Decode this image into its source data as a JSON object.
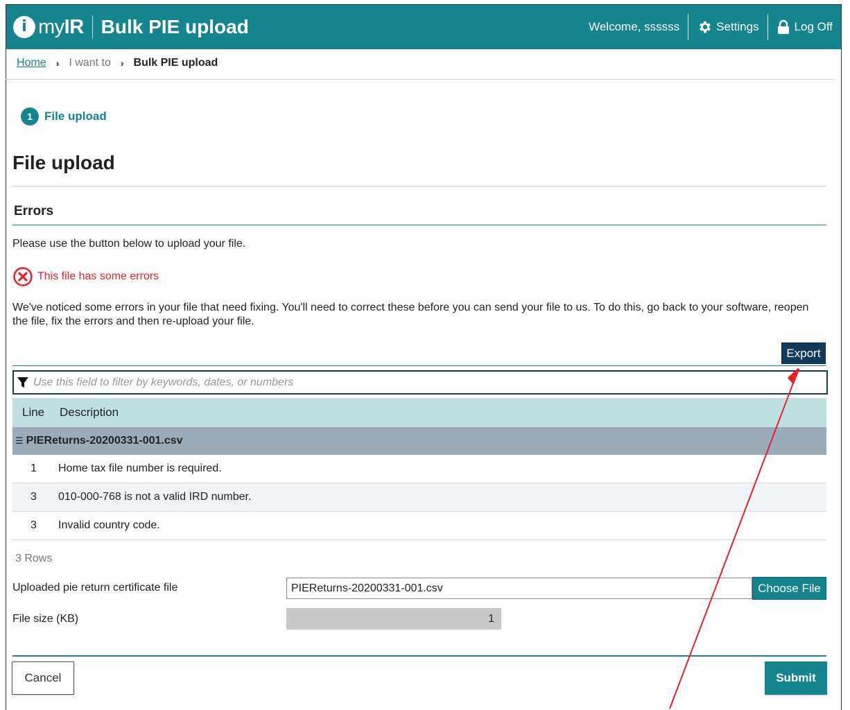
{
  "header": {
    "brand_prefix": "my",
    "brand_bold": "IR",
    "logo_glyph": "i",
    "app_title": "Bulk PIE upload",
    "welcome": "Welcome, ssssss",
    "settings_label": "Settings",
    "logoff_label": "Log Off"
  },
  "breadcrumb": {
    "home": "Home",
    "middle": "I want to",
    "current": "Bulk PIE upload"
  },
  "steps": [
    {
      "number": "1",
      "label": "File upload"
    }
  ],
  "page": {
    "title": "File upload",
    "section_title": "Errors",
    "intro": "Please use the button below to upload your file.",
    "error_message": "This file has some errors",
    "notice": "We've noticed some errors in your file that need fixing. You'll need to correct these before you can send your file to us. To do this, go back to your software, reopen the file, fix the errors and then re-upload your file."
  },
  "toolbar": {
    "export_label": "Export"
  },
  "filter": {
    "placeholder": "Use this field to filter by keywords, dates, or numbers"
  },
  "table": {
    "columns": [
      "Line",
      "Description"
    ],
    "group": "PIEReturns-20200331-001.csv",
    "rows": [
      {
        "line": "1",
        "description": "Home tax file number is required."
      },
      {
        "line": "3",
        "description": "010-000-768 is not a valid IRD number."
      },
      {
        "line": "3",
        "description": "Invalid country code."
      }
    ],
    "row_count": "3 Rows"
  },
  "form": {
    "file_label": "Uploaded pie return certificate file",
    "file_value": "PIEReturns-20200331-001.csv",
    "choose_label": "Choose File",
    "size_label": "File size (KB)",
    "size_value": "1"
  },
  "actions": {
    "cancel_label": "Cancel",
    "submit_label": "Submit"
  },
  "colors": {
    "brand_teal": "#14858e",
    "navy": "#123a5a",
    "error_red": "#e8202a",
    "annotation_red": "#e8202a"
  }
}
